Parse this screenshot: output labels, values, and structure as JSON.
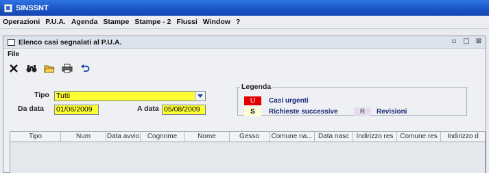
{
  "app": {
    "title": "SINSSNT"
  },
  "menu": [
    "Operazioni",
    "P.U.A.",
    "Agenda",
    "Stampe",
    "Stampe - 2",
    "Flussi",
    "Window",
    "?"
  ],
  "window": {
    "title": "Elenco casi segnalati al P.U.A.",
    "file_menu": "File",
    "controls": [
      "restore",
      "maximize",
      "close"
    ]
  },
  "toolbar": {
    "icons": [
      "close-icon",
      "find-icon",
      "open-folder-icon",
      "print-icon",
      "undo-icon"
    ]
  },
  "filters": {
    "tipo_label": "Tipo",
    "tipo_value": "Tutti",
    "da_data_label": "Da data",
    "da_data_value": "01/06/2009",
    "a_data_label": "A data",
    "a_data_value": "05/08/2009"
  },
  "legend": {
    "title": "Legenda",
    "items": [
      {
        "code": "U",
        "label": "Casi urgenti",
        "color": "#e00000",
        "text_color": "#ffffff"
      },
      {
        "code": "S",
        "label": "Richieste successive",
        "color": "#ffffd6",
        "text_color": "#000000"
      },
      {
        "code": "R",
        "label": "Revisioni",
        "color": "#e6dcf2",
        "text_color": "#333333"
      }
    ]
  },
  "table": {
    "columns": [
      "Tipo",
      "Num",
      "Data avvio",
      "Cognome",
      "Nome",
      "Gesso",
      "Comune na...",
      "Data nasc",
      "Indirizzo res",
      "Comune res",
      "Indirizzo d"
    ]
  },
  "colors": {
    "titlebar": "#1a55c6",
    "field_yellow": "#ffff33"
  }
}
